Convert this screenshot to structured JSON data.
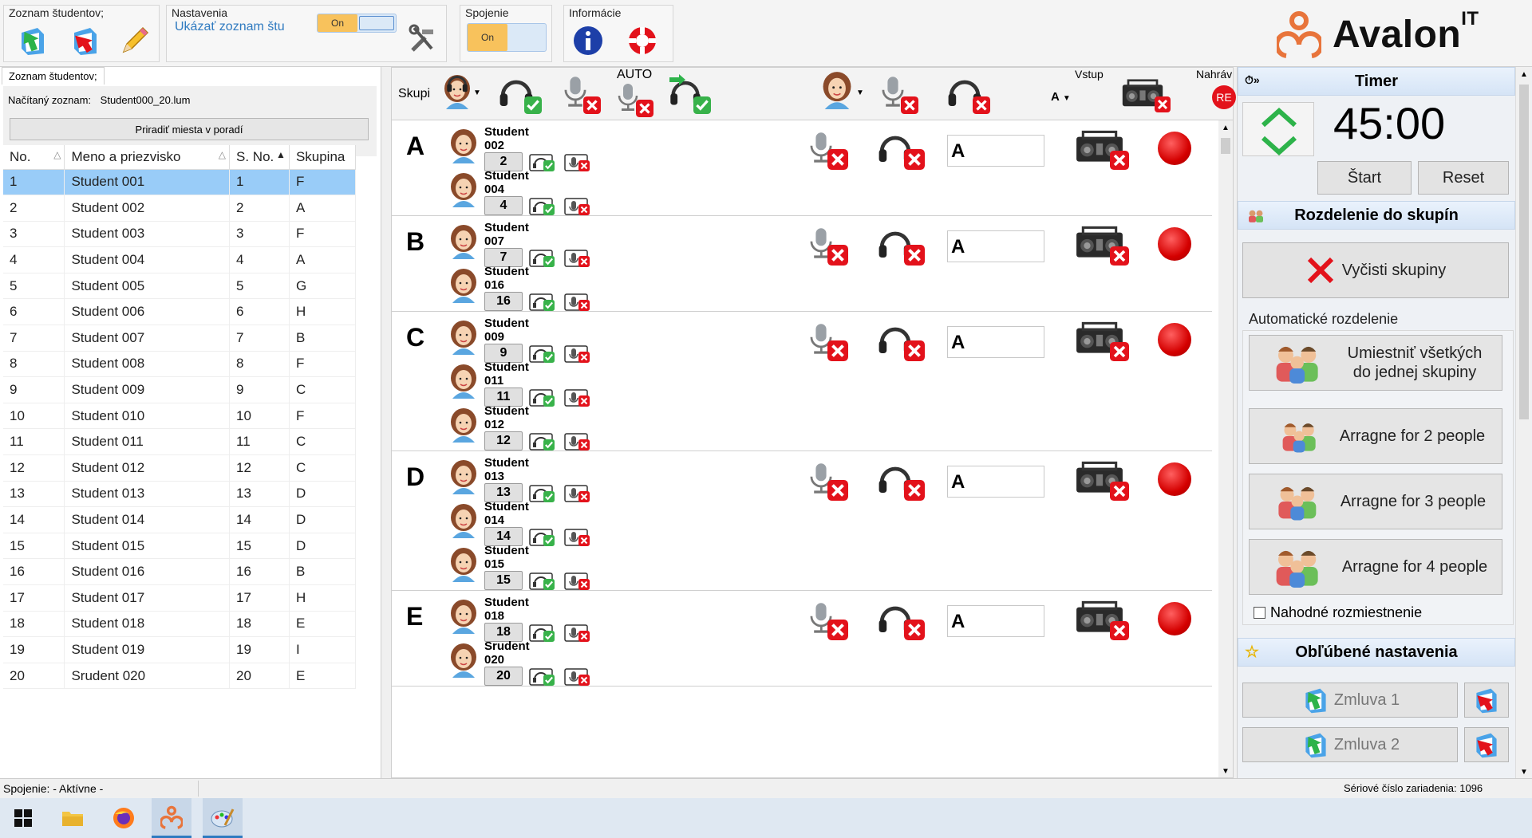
{
  "ribbon": {
    "students_group": "Zoznam študentov;",
    "settings_group": "Nastavenia",
    "settings_link": "Ukázať zoznam štu",
    "settings_toggle": "On",
    "connection_group": "Spojenie",
    "connection_toggle": "On",
    "info_group": "Informácie"
  },
  "logo": {
    "name": "Avalon",
    "suffix": "IT"
  },
  "left_panel": {
    "tab": "Zoznam študentov;",
    "loaded_label": "Načítaný zoznam:",
    "loaded_file": "Student000_20.lum",
    "assign_button": "Priradiť miesta v poradí",
    "columns": [
      "No.",
      "Meno a priezvisko",
      "S. No.",
      "Skupina"
    ],
    "rows": [
      [
        "1",
        "Student 001",
        "1",
        "F"
      ],
      [
        "2",
        "Student 002",
        "2",
        "A"
      ],
      [
        "3",
        "Student 003",
        "3",
        "F"
      ],
      [
        "4",
        "Student 004",
        "4",
        "A"
      ],
      [
        "5",
        "Student 005",
        "5",
        "G"
      ],
      [
        "6",
        "Student 006",
        "6",
        "H"
      ],
      [
        "7",
        "Student 007",
        "7",
        "B"
      ],
      [
        "8",
        "Student 008",
        "8",
        "F"
      ],
      [
        "9",
        "Student 009",
        "9",
        "C"
      ],
      [
        "10",
        "Student 010",
        "10",
        "F"
      ],
      [
        "11",
        "Student 011",
        "11",
        "C"
      ],
      [
        "12",
        "Student 012",
        "12",
        "C"
      ],
      [
        "13",
        "Student 013",
        "13",
        "D"
      ],
      [
        "14",
        "Student 014",
        "14",
        "D"
      ],
      [
        "15",
        "Student 015",
        "15",
        "D"
      ],
      [
        "16",
        "Student 016",
        "16",
        "B"
      ],
      [
        "17",
        "Student 017",
        "17",
        "H"
      ],
      [
        "18",
        "Student 018",
        "18",
        "E"
      ],
      [
        "19",
        "Student 019",
        "19",
        "I"
      ],
      [
        "20",
        "Srudent 020",
        "20",
        "E"
      ]
    ]
  },
  "center_toolbar": {
    "groups_label": "Skupi",
    "auto_label": "AUTO",
    "input_label": "Vstup",
    "input_value": "A",
    "record_label": "Nahráv",
    "record_text": "RE"
  },
  "groups": [
    {
      "letter": "A",
      "input": "A",
      "students": [
        {
          "line1": "Student",
          "line2": "002",
          "num": "2"
        },
        {
          "line1": "Student",
          "line2": "004",
          "num": "4"
        }
      ]
    },
    {
      "letter": "B",
      "input": "A",
      "students": [
        {
          "line1": "Student",
          "line2": "007",
          "num": "7"
        },
        {
          "line1": "Student",
          "line2": "016",
          "num": "16"
        }
      ]
    },
    {
      "letter": "C",
      "input": "A",
      "students": [
        {
          "line1": "Student",
          "line2": "009",
          "num": "9"
        },
        {
          "line1": "Student",
          "line2": "011",
          "num": "11"
        },
        {
          "line1": "Student",
          "line2": "012",
          "num": "12"
        }
      ]
    },
    {
      "letter": "D",
      "input": "A",
      "students": [
        {
          "line1": "Student",
          "line2": "013",
          "num": "13"
        },
        {
          "line1": "Student",
          "line2": "014",
          "num": "14"
        },
        {
          "line1": "Student",
          "line2": "015",
          "num": "15"
        }
      ]
    },
    {
      "letter": "E",
      "input": "A",
      "students": [
        {
          "line1": "Student",
          "line2": "018",
          "num": "18"
        },
        {
          "line1": "Srudent",
          "line2": "020",
          "num": "20"
        }
      ]
    }
  ],
  "right_panel": {
    "timer_title": "Timer",
    "timer_value": "45:00",
    "start_button": "Štart",
    "reset_button": "Reset",
    "groups_title": "Rozdelenie do skupín",
    "clear_button": "Vyčisti skupiny",
    "auto_label": "Automatické rozdelenie",
    "all_one_line1": "Umiestniť všetkých",
    "all_one_line2": "do jednej skupiny",
    "arrange2": "Arragne for 2 people",
    "arrange3": "Arragne for 3 people",
    "arrange4": "Arragne for 4 people",
    "random_label": "Nahodné rozmiestnenie",
    "favorites_title": "Obľúbené nastavenia",
    "fav1": "Zmluva 1",
    "fav2": "Zmluva 2"
  },
  "status": {
    "connection": "Spojenie: - Aktívne -",
    "serial": "Sériové číslo zariadenia: 1096"
  },
  "colors": {
    "accent": "#99ccf8",
    "brand": "#e8743b",
    "header": "#d5e4f6"
  }
}
